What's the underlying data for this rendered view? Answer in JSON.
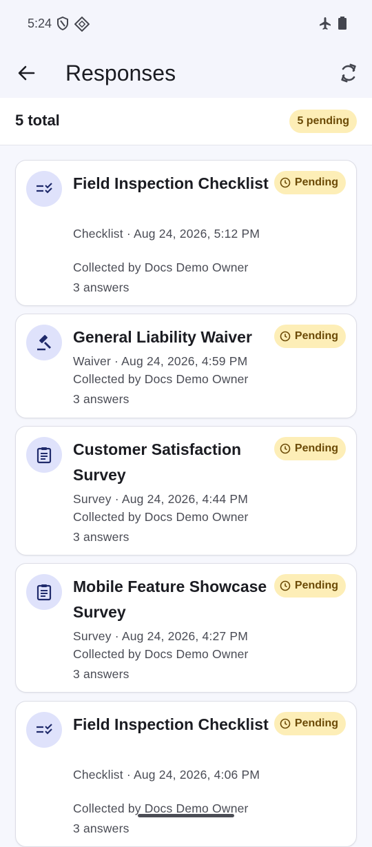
{
  "status": {
    "time": "5:24"
  },
  "header": {
    "title": "Responses"
  },
  "summary": {
    "total": "5 total",
    "pending": "5 pending"
  },
  "cards": [
    {
      "title": "Field Inspection Checklist",
      "meta": "Checklist · Aug 24, 2026, 5:12 PM",
      "collected": "Collected by Docs Demo Owner",
      "answers": "3 answers",
      "badge": "Pending",
      "icon": "checklist-icon"
    },
    {
      "title": "General Liability Waiver",
      "meta": "Waiver · Aug 24, 2026, 4:59 PM",
      "collected": "Collected by Docs Demo Owner",
      "answers": "3 answers",
      "badge": "Pending",
      "icon": "gavel-icon"
    },
    {
      "title": "Customer Satisfaction Survey",
      "meta": "Survey · Aug 24, 2026, 4:44 PM",
      "collected": "Collected by Docs Demo Owner",
      "answers": "3 answers",
      "badge": "Pending",
      "icon": "clipboard-icon"
    },
    {
      "title": "Mobile Feature Showcase Survey",
      "meta": "Survey · Aug 24, 2026, 4:27 PM",
      "collected": "Collected by Docs Demo Owner",
      "answers": "3 answers",
      "badge": "Pending",
      "icon": "clipboard-icon"
    },
    {
      "title": "Field Inspection Checklist",
      "meta": "Checklist · Aug 24, 2026, 4:06 PM",
      "collected": "Collected by Docs Demo Owner",
      "answers": "3 answers",
      "badge": "Pending",
      "icon": "checklist-icon"
    }
  ],
  "colors": {
    "accent": "#1f2a6b",
    "pending_bg": "#fdeeb7",
    "pending_text": "#6b4a06",
    "avatar_bg": "#dfe2fb"
  }
}
